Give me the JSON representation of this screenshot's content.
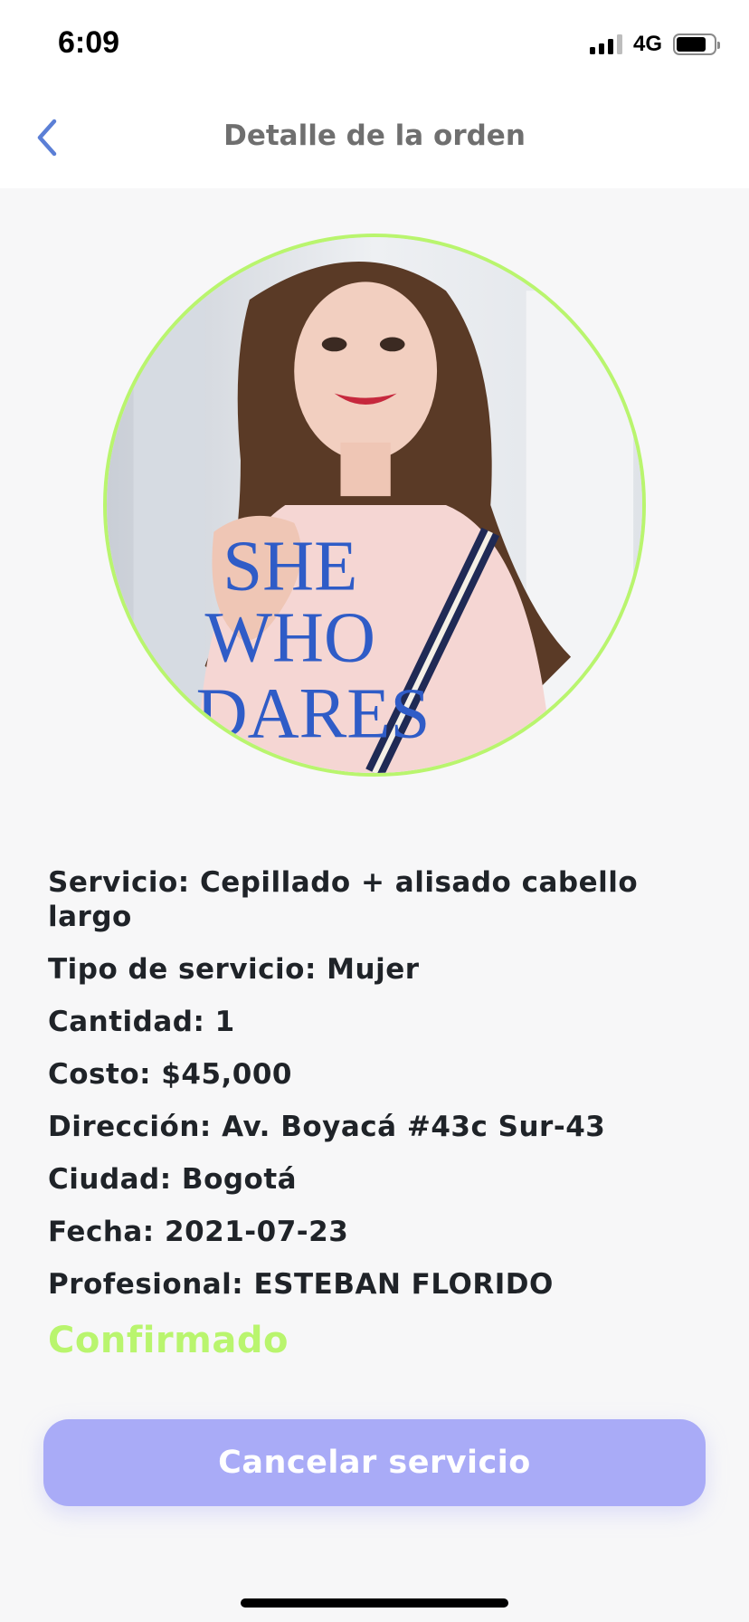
{
  "status_bar": {
    "time": "6:09",
    "network": "4G",
    "icons": [
      "signal-icon",
      "battery-icon"
    ]
  },
  "header": {
    "title": "Detalle de la orden",
    "back_icon": "chevron-left-icon"
  },
  "accent_colors": {
    "primary": "#a9abf7",
    "success": "#b9f56e",
    "title": "#6f6f6f",
    "back": "#5b7fd6"
  },
  "order": {
    "servicio": "Servicio: Cepillado + alisado cabello largo",
    "tipo": "Tipo de servicio: Mujer",
    "cantidad": "Cantidad: 1",
    "costo": "Costo: $45,000",
    "direccion": "Dirección: Av. Boyacá #43c Sur-43",
    "ciudad": "Ciudad: Bogotá",
    "fecha": "Fecha: 2021-07-23",
    "profesional": "Profesional: ESTEBAN FLORIDO",
    "status": "Confirmado"
  },
  "photo_shirt_text": [
    "SHE",
    "WHO",
    "DARES"
  ],
  "actions": {
    "cancel_label": "Cancelar servicio"
  }
}
